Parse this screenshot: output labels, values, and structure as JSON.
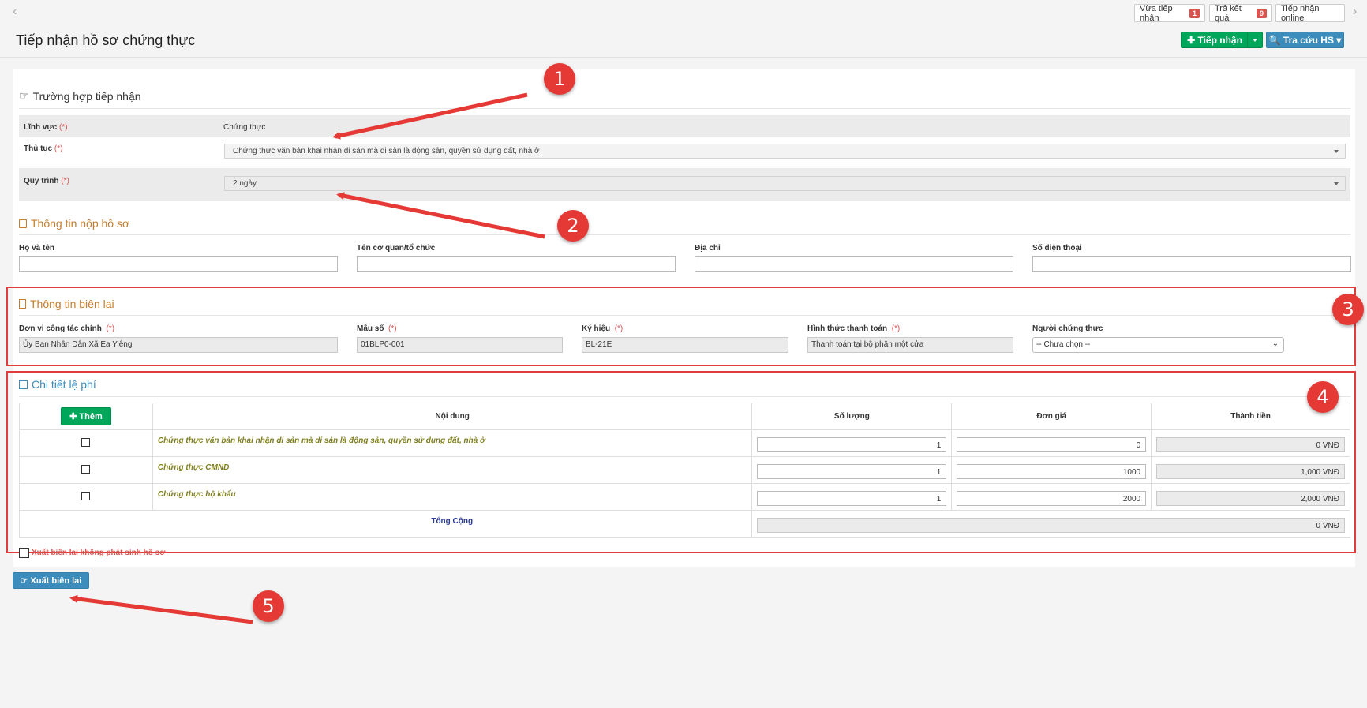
{
  "topbar": {
    "vua_tiep_nhan": {
      "label": "Vừa tiếp nhận",
      "count": "1"
    },
    "tra_ket_qua": {
      "label": "Trả kết quả",
      "count": "9"
    },
    "tiep_nhan_online": "Tiếp nhận online"
  },
  "page": {
    "title": "Tiếp nhận hồ sơ chứng thực",
    "btn_tiep_nhan": "✚ Tiếp nhận",
    "btn_tra_cuu": "🔍 Tra cứu HS ▾"
  },
  "truong_hop": {
    "title": "Trường hợp tiếp nhận",
    "linh_vuc_label": "Lĩnh vực",
    "linh_vuc_value": "Chứng thực",
    "thu_tuc_label": "Thủ tục",
    "thu_tuc_value": "Chứng thực văn bản khai nhận di sản mà di sản là động sản, quyền sử dụng đất, nhà ở",
    "quy_trinh_label": "Quy trình",
    "quy_trinh_value": "2 ngày",
    "required_mark": "(*)"
  },
  "nop_ho_so": {
    "title": "Thông tin nộp hồ sơ",
    "fields": [
      "Họ và tên",
      "Tên cơ quan/tổ chức",
      "Địa chỉ",
      "Số điện thoại"
    ]
  },
  "bien_lai": {
    "title": "Thông tin biên lai",
    "don_vi_label": "Đơn vị công tác chính",
    "don_vi_value": "Ủy Ban Nhân Dân Xã Ea Yiêng",
    "mau_so_label": "Mẫu số",
    "mau_so_value": "01BLP0-001",
    "ky_hieu_label": "Ký hiệu",
    "ky_hieu_value": "BL-21E",
    "hinh_thuc_label": "Hình thức thanh toán",
    "hinh_thuc_value": "Thanh toán tại bộ phận một cửa",
    "nguoi_label": "Người chứng thực",
    "nguoi_value": "-- Chưa chọn --"
  },
  "le_phi": {
    "title": "Chi tiết lệ phí",
    "btn_them": "✚ Thêm",
    "headers": [
      "Nội dung",
      "Số lượng",
      "Đơn giá",
      "Thành tiền"
    ],
    "rows": [
      {
        "noi_dung": "Chứng thực văn bản khai nhận di sản mà di sản là động sản, quyền sử dụng đất, nhà ở",
        "so_luong": "1",
        "don_gia": "0",
        "thanh_tien": "0 VNĐ"
      },
      {
        "noi_dung": "Chứng thực CMND",
        "so_luong": "1",
        "don_gia": "1000",
        "thanh_tien": "1,000 VNĐ"
      },
      {
        "noi_dung": "Chứng thực hộ khẩu",
        "so_luong": "1",
        "don_gia": "2000",
        "thanh_tien": "2,000 VNĐ"
      }
    ],
    "tong_cong_label": "Tổng Cộng",
    "tong_cong_value": "0 VNĐ"
  },
  "xuat": {
    "checkbox_label": "Xuất biên lai không phát sinh hồ sơ",
    "button": "Xuất biên lai"
  },
  "callouts": [
    "1",
    "2",
    "3",
    "4",
    "5"
  ],
  "colors": {
    "annotation": "#e53935",
    "primary": "#3c8dbc",
    "success": "#00a65a"
  }
}
